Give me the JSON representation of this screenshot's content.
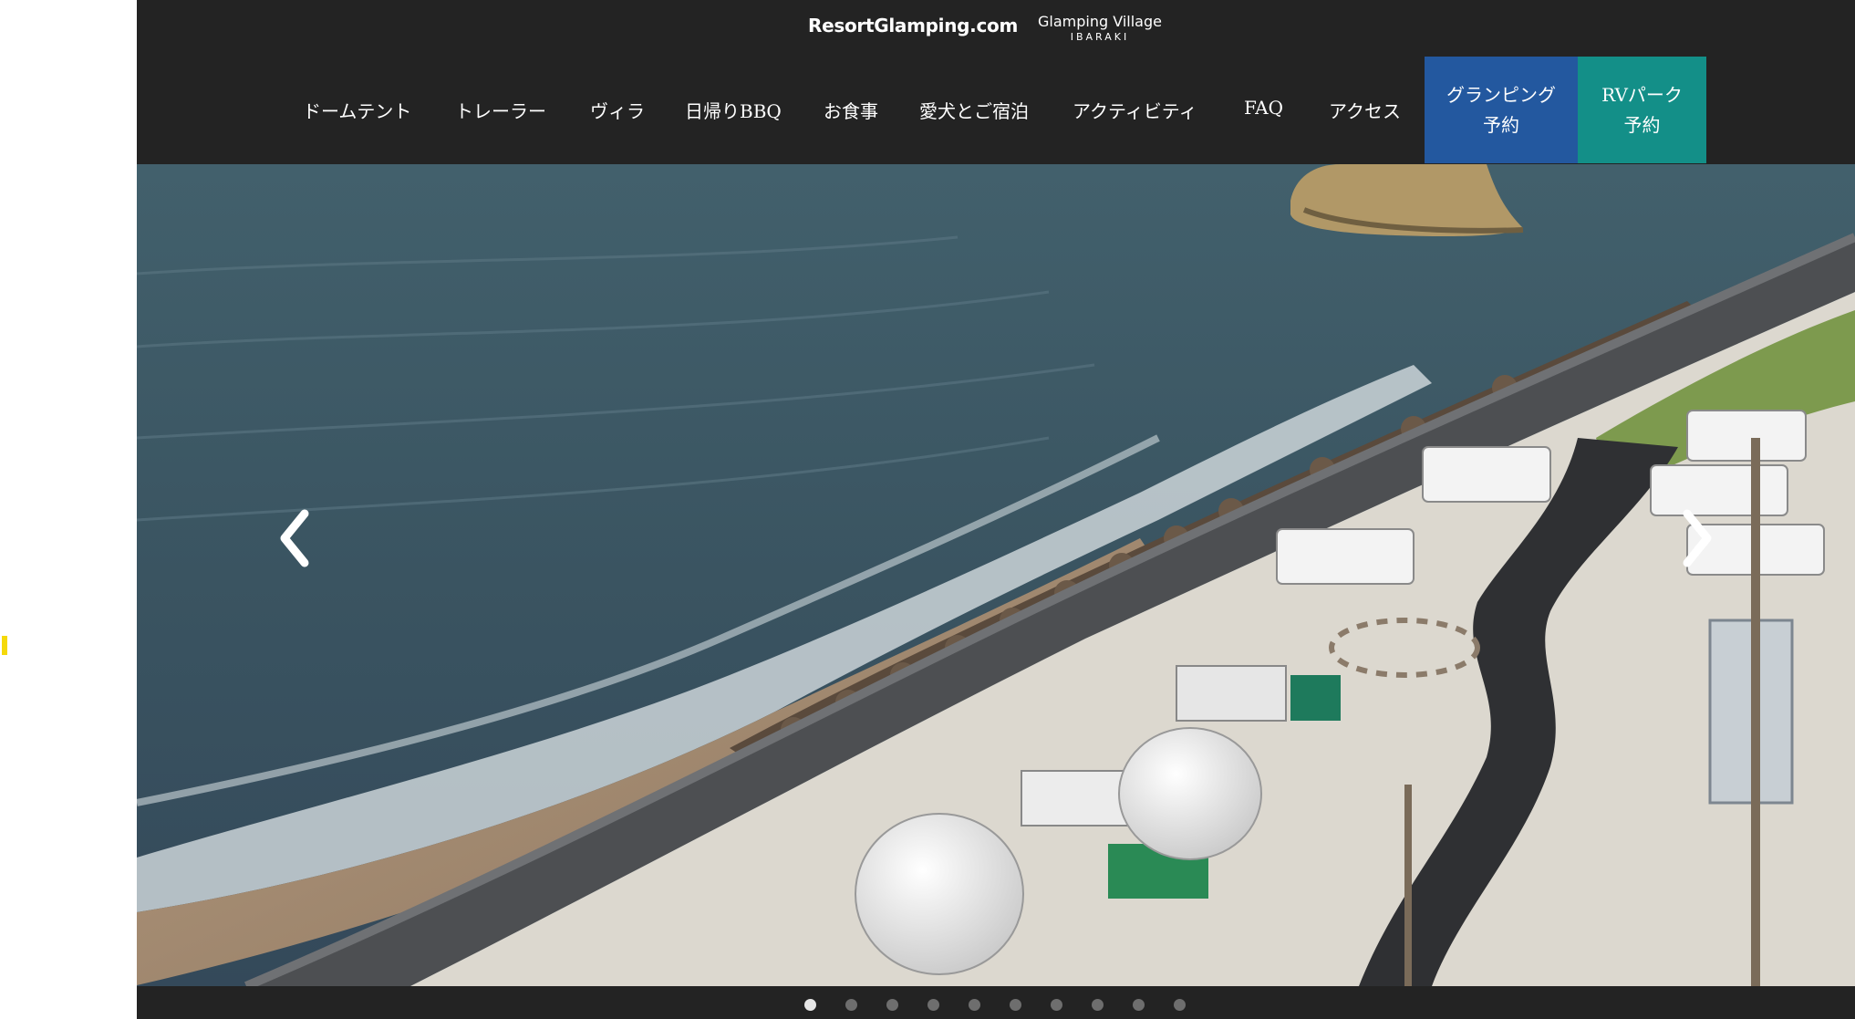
{
  "header": {
    "logo_main": "ResortGlamping.com",
    "logo_sub_line1": "Glamping Village",
    "logo_sub_line2": "IBARAKI"
  },
  "nav": {
    "items": [
      {
        "label": "ドームテント"
      },
      {
        "label": "トレーラー"
      },
      {
        "label": "ヴィラ"
      },
      {
        "label": "日帰りBBQ"
      },
      {
        "label": "お食事"
      },
      {
        "label": "愛犬とご宿泊"
      },
      {
        "label": "アクティビティ"
      },
      {
        "label": "FAQ"
      },
      {
        "label": "アクセス"
      }
    ],
    "cta_glamping": {
      "line1": "グランピング",
      "line2": "予約",
      "color": "#23589f"
    },
    "cta_rv": {
      "line1": "RVパーク",
      "line2": "予約",
      "color": "#138f88"
    }
  },
  "hero": {
    "image": "aerial-coastal-glamping-site",
    "prev_icon": "chevron-left-icon",
    "next_icon": "chevron-right-icon"
  },
  "slider": {
    "total_slides": 10,
    "active_index": 0
  },
  "colors": {
    "header_bg": "#232323",
    "sea": "#3d5662",
    "accent_blue": "#23589f",
    "accent_teal": "#138f88"
  }
}
